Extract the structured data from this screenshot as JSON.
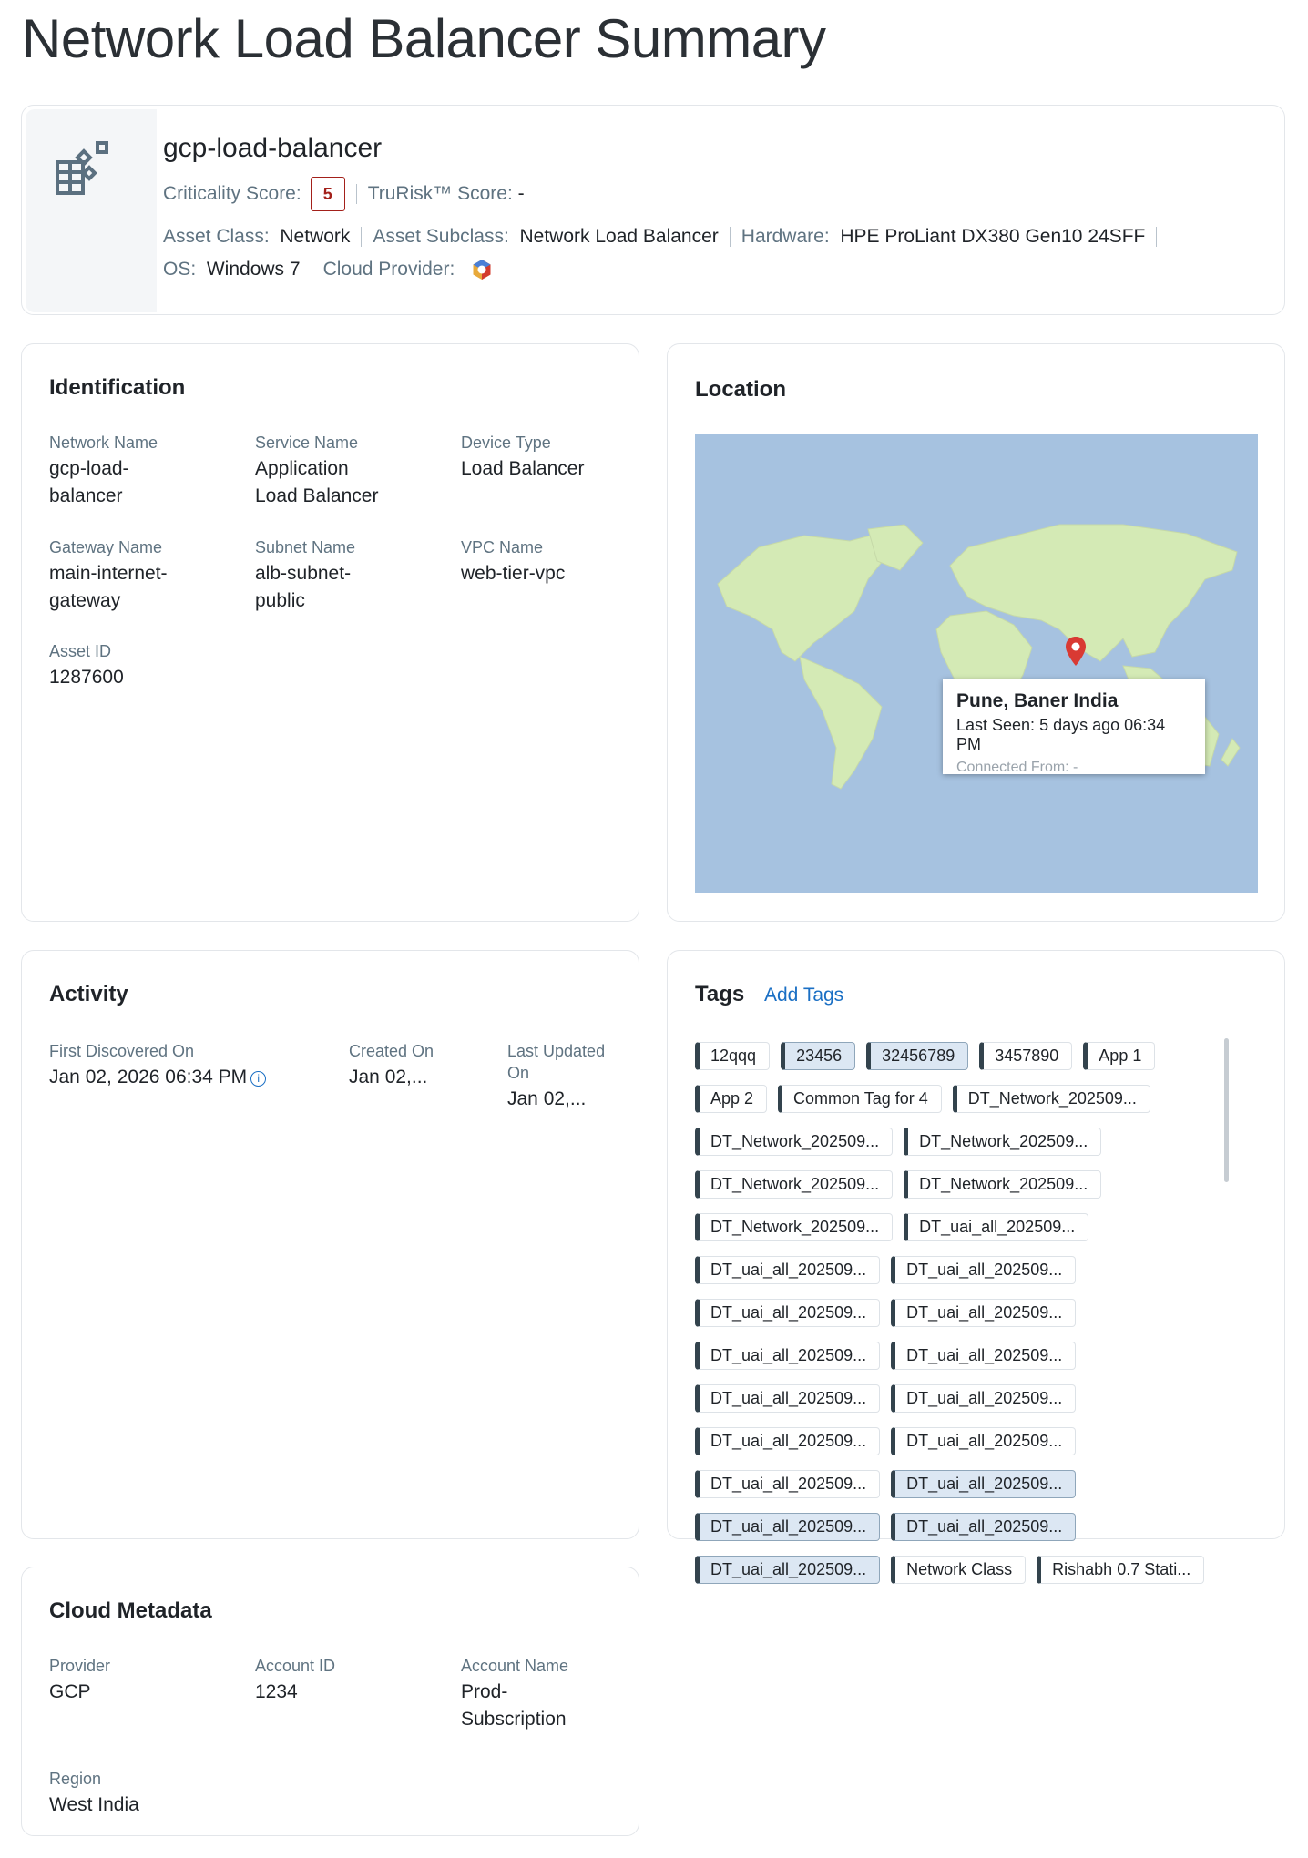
{
  "page": {
    "title": "Network Load Balancer Summary"
  },
  "header": {
    "asset_name": "gcp-load-balancer",
    "criticality_label": "Criticality Score:",
    "criticality_value": "5",
    "trurisk_label": "TruRisk™ Score:",
    "trurisk_value": "-",
    "asset_class_label": "Asset Class:",
    "asset_class": "Network",
    "asset_subclass_label": "Asset Subclass:",
    "asset_subclass": "Network Load Balancer",
    "hardware_label": "Hardware:",
    "hardware": "HPE ProLiant DX380 Gen10 24SFF",
    "os_label": "OS:",
    "os": "Windows 7",
    "cloud_provider_label": "Cloud Provider:",
    "cloud_provider_icon": "gcp-logo-icon"
  },
  "identification": {
    "title": "Identification",
    "fields": [
      {
        "label": "Network Name",
        "value": "gcp-load-balancer"
      },
      {
        "label": "Service Name",
        "value": "Application Load Balancer"
      },
      {
        "label": "Device Type",
        "value": "Load Balancer"
      },
      {
        "label": "Gateway Name",
        "value": "main-internet-gateway"
      },
      {
        "label": "Subnet Name",
        "value": "alb-subnet-public"
      },
      {
        "label": "VPC Name",
        "value": "web-tier-vpc"
      },
      {
        "label": "Asset ID",
        "value": "1287600"
      }
    ]
  },
  "location": {
    "title": "Location",
    "place": "Pune, Baner India",
    "last_seen": "Last Seen: 5 days ago 06:34 PM",
    "connected_from": "Connected From: -"
  },
  "activity": {
    "title": "Activity",
    "fields": [
      {
        "label": "First Discovered On",
        "value": "Jan 02, 2026 06:34 PM"
      },
      {
        "label": "Created On",
        "value": "Jan 02,..."
      },
      {
        "label": "Last Updated On",
        "value": "Jan 02,..."
      }
    ]
  },
  "tags": {
    "title": "Tags",
    "add_label": "Add Tags",
    "items": [
      {
        "label": "12qqq",
        "selected": false
      },
      {
        "label": "23456",
        "selected": true
      },
      {
        "label": "32456789",
        "selected": true
      },
      {
        "label": "3457890",
        "selected": false
      },
      {
        "label": "App 1",
        "selected": false
      },
      {
        "label": "App 2",
        "selected": false
      },
      {
        "label": "Common Tag for 4",
        "selected": false
      },
      {
        "label": "DT_Network_202509...",
        "selected": false
      },
      {
        "label": "DT_Network_202509...",
        "selected": false
      },
      {
        "label": "DT_Network_202509...",
        "selected": false
      },
      {
        "label": "DT_Network_202509...",
        "selected": false
      },
      {
        "label": "DT_Network_202509...",
        "selected": false
      },
      {
        "label": "DT_Network_202509...",
        "selected": false
      },
      {
        "label": "DT_uai_all_202509...",
        "selected": false
      },
      {
        "label": "DT_uai_all_202509...",
        "selected": false
      },
      {
        "label": "DT_uai_all_202509...",
        "selected": false
      },
      {
        "label": "DT_uai_all_202509...",
        "selected": false
      },
      {
        "label": "DT_uai_all_202509...",
        "selected": false
      },
      {
        "label": "DT_uai_all_202509...",
        "selected": false
      },
      {
        "label": "DT_uai_all_202509...",
        "selected": false
      },
      {
        "label": "DT_uai_all_202509...",
        "selected": false
      },
      {
        "label": "DT_uai_all_202509...",
        "selected": false
      },
      {
        "label": "DT_uai_all_202509...",
        "selected": false
      },
      {
        "label": "DT_uai_all_202509...",
        "selected": false
      },
      {
        "label": "DT_uai_all_202509...",
        "selected": false
      },
      {
        "label": "DT_uai_all_202509...",
        "selected": true
      },
      {
        "label": "DT_uai_all_202509...",
        "selected": true
      },
      {
        "label": "DT_uai_all_202509...",
        "selected": true
      },
      {
        "label": "DT_uai_all_202509...",
        "selected": true
      },
      {
        "label": "Network Class",
        "selected": false
      },
      {
        "label": "Rishabh 0.7 Stati...",
        "selected": false
      }
    ]
  },
  "cloud_metadata": {
    "title": "Cloud Metadata",
    "fields": [
      {
        "label": "Provider",
        "value": "GCP"
      },
      {
        "label": "Account ID",
        "value": "1234"
      },
      {
        "label": "Account Name",
        "value": "Prod-Subscription"
      },
      {
        "label": "Region",
        "value": "West India"
      }
    ]
  }
}
